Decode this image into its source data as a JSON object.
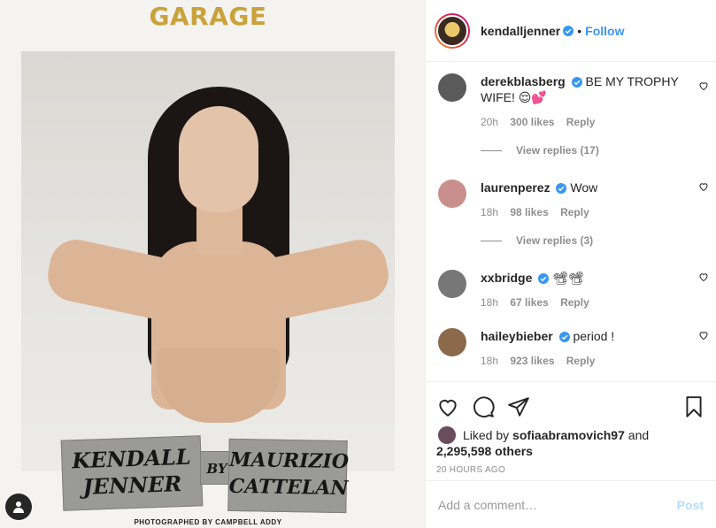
{
  "media": {
    "magazine_title": "GARAGE",
    "tape_left": [
      "KENDALL",
      "JENNER"
    ],
    "tape_mid": "BY",
    "tape_right": [
      "MAURIZIO",
      "CATTELAN"
    ],
    "credit": "PHOTOGRAPHED BY CAMPBELL ADDY"
  },
  "header": {
    "username": "kendalljenner",
    "separator": "•",
    "follow_label": "Follow"
  },
  "comments": [
    {
      "username": "derekblasberg",
      "text": "BE MY TROPHY WIFE! 😌💕",
      "time": "20h",
      "likes": "300 likes",
      "reply": "Reply",
      "view_replies": "View replies (17)",
      "verified": true,
      "avatar_color": "#5a5a5a"
    },
    {
      "username": "laurenperez",
      "text": "Wow",
      "time": "18h",
      "likes": "98 likes",
      "reply": "Reply",
      "view_replies": "View replies (3)",
      "verified": true,
      "avatar_color": "#c98f8c"
    },
    {
      "username": "xxbridge",
      "text": "📽📽",
      "time": "18h",
      "likes": "67 likes",
      "reply": "Reply",
      "verified": true,
      "avatar_color": "#777"
    },
    {
      "username": "haileybieber",
      "text": "period !",
      "time": "18h",
      "likes": "923 likes",
      "reply": "Reply",
      "verified": true,
      "avatar_color": "#8a6a4a"
    }
  ],
  "likes": {
    "prefix": "Liked by",
    "user": "sofiaabramovich97",
    "and": "and",
    "count": "2,295,598 others"
  },
  "timestamp": "20 HOURS AGO",
  "add_comment": {
    "placeholder": "Add a comment…",
    "post_label": "Post"
  },
  "colors": {
    "accent": "#3897f0",
    "post_disabled": "#b2dffc",
    "gold": "#c9a23b"
  }
}
